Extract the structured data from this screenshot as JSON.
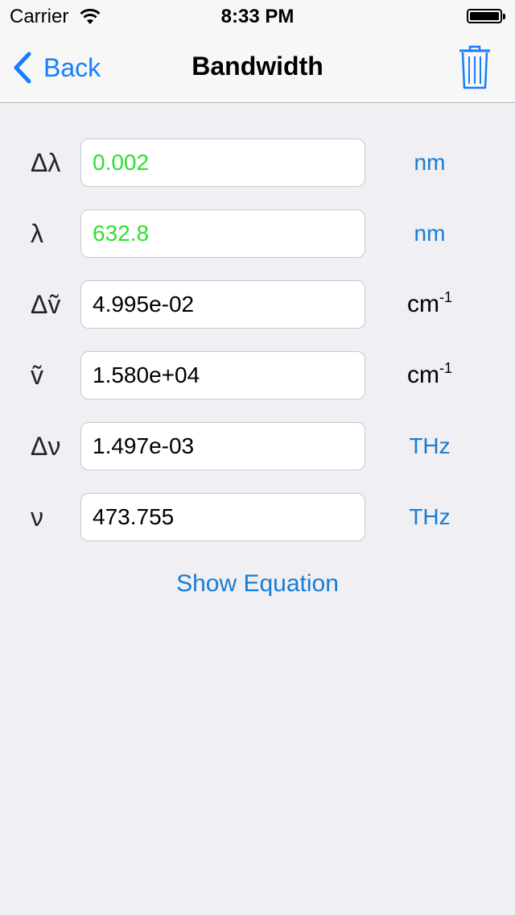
{
  "status": {
    "carrier": "Carrier",
    "time": "8:33 PM"
  },
  "nav": {
    "back_label": "Back",
    "title": "Bandwidth"
  },
  "rows": [
    {
      "symbol": "Δλ",
      "value": "0.002",
      "unit": "nm"
    },
    {
      "symbol": "λ",
      "value": "632.8",
      "unit": "nm"
    },
    {
      "symbol": "Δṽ",
      "value": "4.995e-02",
      "unit": "cm",
      "unit_sup": "-1"
    },
    {
      "symbol": "ṽ",
      "value": "1.580e+04",
      "unit": "cm",
      "unit_sup": "-1"
    },
    {
      "symbol": "Δν",
      "value": "1.497e-03",
      "unit": "THz"
    },
    {
      "symbol": "ν",
      "value": "473.755",
      "unit": "THz"
    }
  ],
  "show_equation_label": "Show Equation",
  "colors": {
    "accent": "#157efb",
    "unit_blue": "#1a7ccf",
    "input_value_green": "#2ee02e",
    "background": "#efeff4"
  }
}
